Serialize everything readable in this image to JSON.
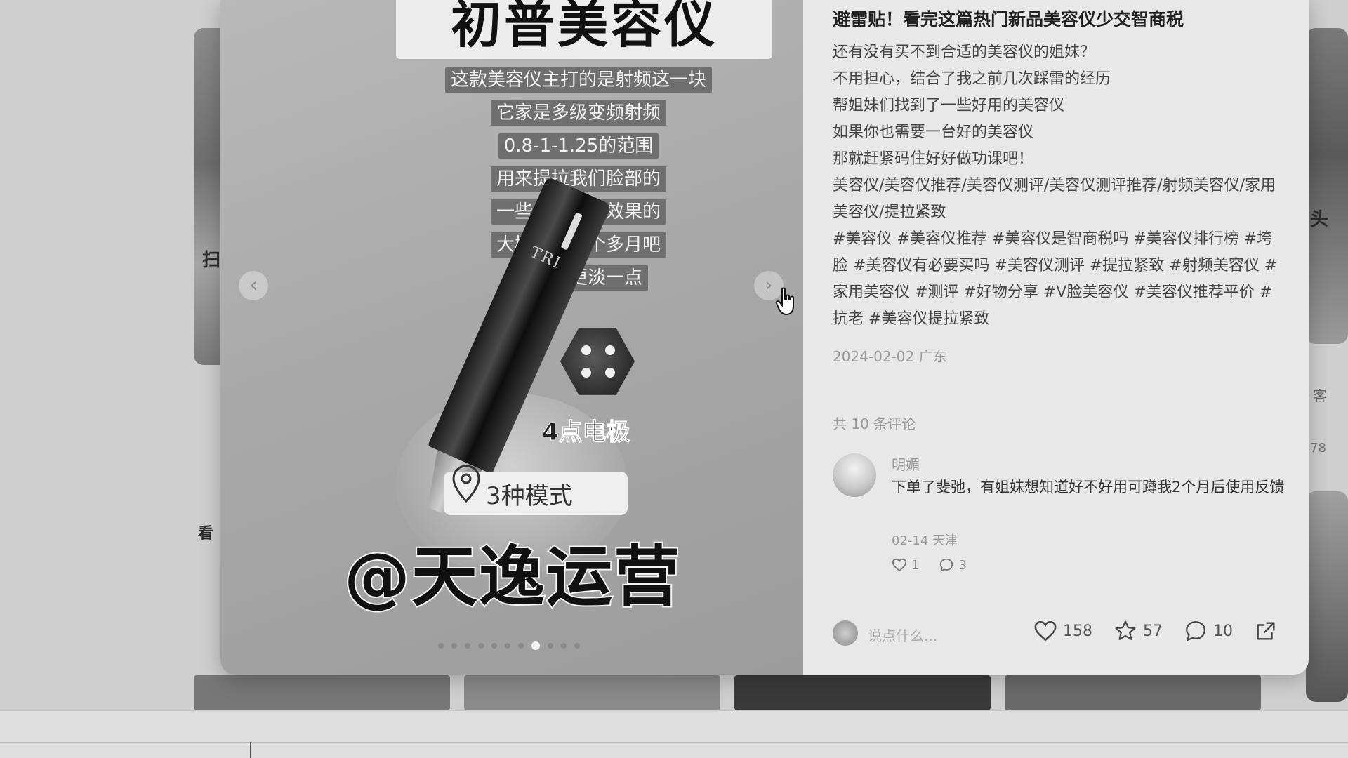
{
  "feed": {
    "left_side_chars": [
      "扫",
      "看"
    ],
    "right_side_chars": [
      "头"
    ],
    "right_meta": [
      "客",
      "78"
    ]
  },
  "media": {
    "image_title": "初普美容仪",
    "captions": [
      "这款美容仪主打的是射频这一块",
      "它家是多级变频射频",
      "0.8-1-1.25的范围",
      "用来提拉我们脸部的",
      "一些细纹是有效果的",
      "大概用了一个多月吧",
      "细纹会更淡一点"
    ],
    "device_logo": "TRI",
    "electrode_label": "4点电极",
    "mode_label": "3种模式",
    "watermark": "@天逸运营",
    "prev_arrow": "‹",
    "next_arrow": "›",
    "slide_count": 11,
    "active_slide": 8
  },
  "note": {
    "title": "避雷贴！看完这篇热门新品美容仪少交智商税",
    "desc_lines": [
      "还有没有买不到合适的美容仪的姐妹？",
      "不用担心，结合了我之前几次踩雷的经历",
      "帮姐妹们找到了一些好用的美容仪",
      "如果你也需要一台好的美容仪",
      "那就赶紧码住好好做功课吧！"
    ],
    "keywords": "美容仪/美容仪推荐/美容仪测评/美容仪测评推荐/射频美容仪/家用美容仪/提拉紧致",
    "hashtags": "#美容仪 #美容仪推荐 #美容仪是智商税吗 #美容仪排行榜 #垮脸 #美容仪有必要买吗 #美容仪测评 #提拉紧致 #射频美容仪 #家用美容仪 #测评 #好物分享 #V脸美容仪 #美容仪推荐平价 #抗老 #美容仪提拉紧致",
    "date_location": "2024-02-02 广东",
    "comment_total": "共 10 条评论"
  },
  "comment": {
    "author": "明媚",
    "text": "下单了斐弛，有姐妹想知道好不好用可蹲我2个月后使用反馈",
    "meta": "02-14 天津",
    "likes": "1",
    "replies": "3"
  },
  "footer": {
    "placeholder": "说点什么...",
    "likes": "158",
    "collects": "57",
    "comments": "10"
  },
  "colors": {
    "page_bg": "#d6d6d6",
    "text_pane_bg": "#e8e8e8",
    "caption_bg": "#6f6f6f"
  }
}
